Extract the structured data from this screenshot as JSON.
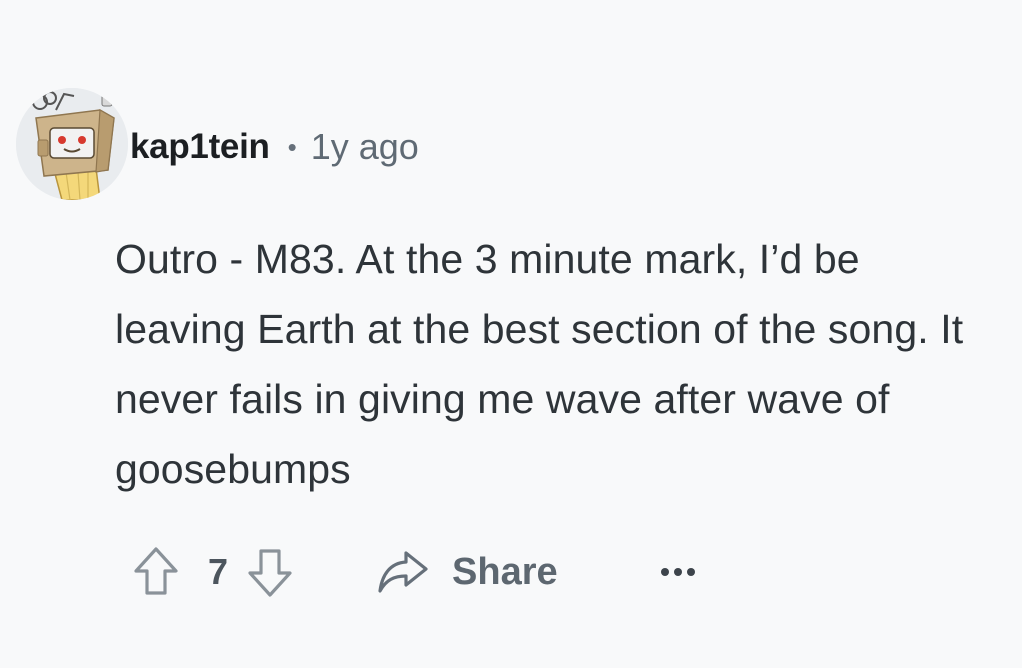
{
  "comment": {
    "author": "kap1tein",
    "separator": "•",
    "timestamp": "1y ago",
    "avatar_icon": "robot-snoo-avatar",
    "body": "Outro - M83. At the 3 minute mark, I’d be leaving Earth at the best section of the song. It never fails in giving me wave after wave of goosebumps",
    "actions": {
      "upvote_icon": "upvote-arrow-icon",
      "score": "7",
      "downvote_icon": "downvote-arrow-icon",
      "share_icon": "share-arrow-icon",
      "share_label": "Share",
      "more_icon": "more-options-icon"
    }
  },
  "colors": {
    "background": "#f8f9fa",
    "text": "#2e3439",
    "muted": "#5f6a74",
    "icon": "#8a9299"
  }
}
